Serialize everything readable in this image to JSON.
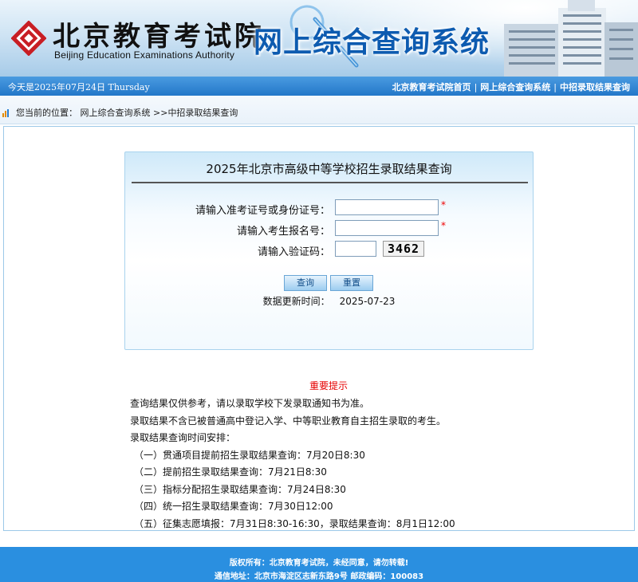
{
  "header": {
    "logo_cn": "北京教育考试院",
    "logo_en": "Beijing Education Examinations Authority",
    "site_title": "网上综合查询系统"
  },
  "topbar": {
    "date_text": "今天是2025年07月24日 Thursday",
    "links": [
      "北京教育考试院首页",
      "网上综合查询系统",
      "中招录取结果查询"
    ],
    "separator": "|"
  },
  "breadcrumb": {
    "prefix": "您当前的位置：",
    "item1": "网上综合查询系统",
    "arrow": ">>",
    "item2": "中招录取结果查询"
  },
  "query": {
    "title": "2025年北京市高级中等学校招生录取结果查询",
    "fields": [
      {
        "label": "请输入准考证号或身份证号：",
        "value": "",
        "required_mark": "*"
      },
      {
        "label": "请输入考生报名号：",
        "value": "",
        "required_mark": "*"
      },
      {
        "label": "请输入验证码：",
        "value": ""
      }
    ],
    "captcha_text": "3462",
    "submit_label": "查询",
    "reset_label": "重置",
    "update_label": "数据更新时间：",
    "update_date": "2025-07-23"
  },
  "notice": {
    "title": "重要提示",
    "lines": [
      "查询结果仅供参考，请以录取学校下发录取通知书为准。",
      "录取结果不含已被普通高中登记入学、中等职业教育自主招生录取的考生。",
      "录取结果查询时间安排：",
      "（一）贯通项目提前招生录取结果查询：7月20日8:30",
      "（二）提前招生录取结果查询：7月21日8:30",
      "（三）指标分配招生录取结果查询：7月24日8:30",
      "（四）统一招生录取结果查询：7月30日12:00",
      "（五）征集志愿填报：7月31日8:30-16:30，录取结果查询：8月1日12:00"
    ]
  },
  "footer": {
    "line1": "版权所有：北京教育考试院，未经同意，请勿转载!",
    "line2": "通信地址：北京市海淀区志新东路9号 邮政编码：100083"
  },
  "colors": {
    "topbar": "#2377c9",
    "title_blue": "#0d5bb0",
    "required_red": "#e00000",
    "footer": "#2a8fe0"
  }
}
